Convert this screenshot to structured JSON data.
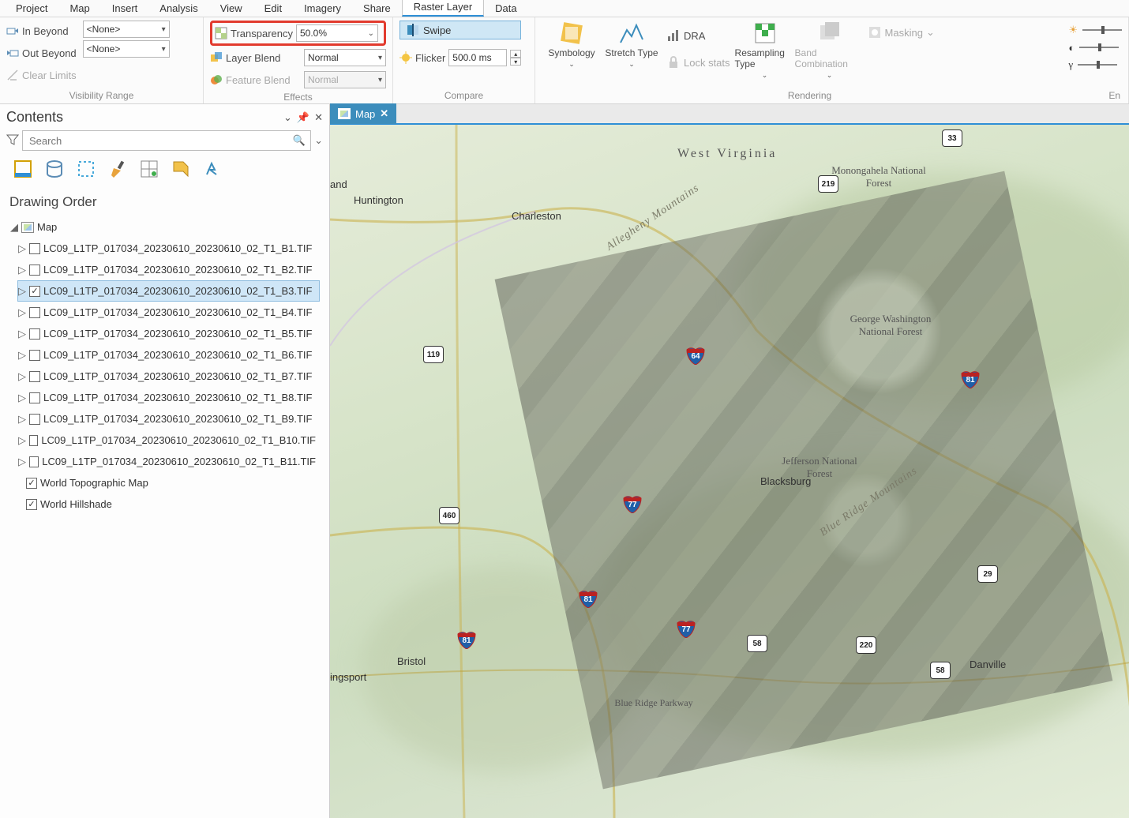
{
  "menubar": {
    "items": [
      "Project",
      "Map",
      "Insert",
      "Analysis",
      "View",
      "Edit",
      "Imagery",
      "Share",
      "Raster Layer",
      "Data"
    ],
    "active": "Raster Layer"
  },
  "ribbon": {
    "visibility": {
      "in_beyond": {
        "label": "In Beyond",
        "value": "<None>"
      },
      "out_beyond": {
        "label": "Out Beyond",
        "value": "<None>"
      },
      "clear_limits": "Clear Limits",
      "group": "Visibility Range"
    },
    "effects": {
      "transparency": {
        "label": "Transparency",
        "value": "50.0%"
      },
      "layer_blend": {
        "label": "Layer Blend",
        "value": "Normal"
      },
      "feature_blend": {
        "label": "Feature Blend",
        "value": "Normal"
      },
      "group": "Effects"
    },
    "compare": {
      "swipe": "Swipe",
      "flicker_label": "Flicker",
      "flicker_value": "500.0  ms",
      "group": "Compare"
    },
    "rendering": {
      "symbology": "Symbology",
      "stretch": "Stretch Type",
      "dra": "DRA",
      "lock_stats": "Lock stats",
      "resampling": "Resampling Type",
      "band_combo": "Band Combination",
      "masking": "Masking",
      "group": "Rendering"
    },
    "enh_group": "En"
  },
  "contents": {
    "title": "Contents",
    "search_placeholder": "Search",
    "drawing_order": "Drawing Order",
    "map_label": "Map",
    "layers": [
      {
        "name": "LC09_L1TP_017034_20230610_20230610_02_T1_B1.TIF",
        "checked": false,
        "selected": false
      },
      {
        "name": "LC09_L1TP_017034_20230610_20230610_02_T1_B2.TIF",
        "checked": false,
        "selected": false
      },
      {
        "name": "LC09_L1TP_017034_20230610_20230610_02_T1_B3.TIF",
        "checked": true,
        "selected": true
      },
      {
        "name": "LC09_L1TP_017034_20230610_20230610_02_T1_B4.TIF",
        "checked": false,
        "selected": false
      },
      {
        "name": "LC09_L1TP_017034_20230610_20230610_02_T1_B5.TIF",
        "checked": false,
        "selected": false
      },
      {
        "name": "LC09_L1TP_017034_20230610_20230610_02_T1_B6.TIF",
        "checked": false,
        "selected": false
      },
      {
        "name": "LC09_L1TP_017034_20230610_20230610_02_T1_B7.TIF",
        "checked": false,
        "selected": false
      },
      {
        "name": "LC09_L1TP_017034_20230610_20230610_02_T1_B8.TIF",
        "checked": false,
        "selected": false
      },
      {
        "name": "LC09_L1TP_017034_20230610_20230610_02_T1_B9.TIF",
        "checked": false,
        "selected": false
      },
      {
        "name": "LC09_L1TP_017034_20230610_20230610_02_T1_B10.TIF",
        "checked": false,
        "selected": false
      },
      {
        "name": "LC09_L1TP_017034_20230610_20230610_02_T1_B11.TIF",
        "checked": false,
        "selected": false
      }
    ],
    "basemaps": [
      {
        "name": "World Topographic Map",
        "checked": true
      },
      {
        "name": "World Hillshade",
        "checked": true
      }
    ]
  },
  "mapview": {
    "tab": "Map",
    "labels": {
      "westvirginia": "West Virginia",
      "charleston": "Charleston",
      "huntington": "Huntington",
      "bristol": "Bristol",
      "danville": "Danville",
      "blacksburg": "Blacksburg",
      "kingsport": "ingsport",
      "and": "and",
      "monongahela": "Monongahela National Forest",
      "gwash": "George Washington National Forest",
      "jefferson": "Jefferson National Forest",
      "blueridge": "Blue Ridge Parkway",
      "allegheny": "Allegheny Mountains",
      "blueridgemtn": "Blue Ridge Mountains"
    },
    "shields": {
      "i64": "64",
      "i77a": "77",
      "i77b": "77",
      "i81a": "81",
      "i81b": "81",
      "us33": "33",
      "us219": "219",
      "us119": "119",
      "us460": "460",
      "us58a": "58",
      "us58b": "58",
      "us29": "29",
      "us220": "220"
    }
  }
}
